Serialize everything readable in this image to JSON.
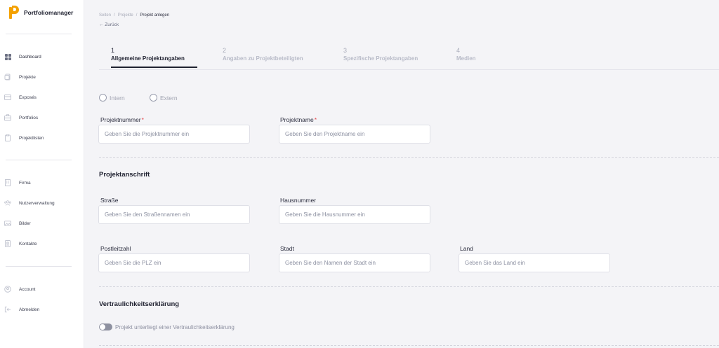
{
  "app": {
    "name": "Portfoliomanager",
    "brand_color": "#f4a100"
  },
  "sidebar": {
    "groups": [
      [
        {
          "label": "Dashboard",
          "icon": "dashboard-icon"
        },
        {
          "label": "Projekte",
          "icon": "projects-icon"
        },
        {
          "label": "Exposés",
          "icon": "expose-icon"
        },
        {
          "label": "Portfolios",
          "icon": "portfolio-icon"
        },
        {
          "label": "Projektlisten",
          "icon": "list-icon"
        }
      ],
      [
        {
          "label": "Firma",
          "icon": "building-icon"
        },
        {
          "label": "Nutzerverwaltung",
          "icon": "users-icon"
        },
        {
          "label": "Bilder",
          "icon": "image-icon"
        },
        {
          "label": "Kontakte",
          "icon": "contact-icon"
        }
      ],
      [
        {
          "label": "Account",
          "icon": "account-icon"
        },
        {
          "label": "Abmelden",
          "icon": "logout-icon"
        }
      ]
    ]
  },
  "breadcrumb": {
    "items": [
      "Seiten",
      "Projekte",
      "Projekt anlegen"
    ],
    "back": "← Zurück"
  },
  "steps": [
    {
      "num": "1",
      "label": "Allgemeine Projektangaben",
      "active": true
    },
    {
      "num": "2",
      "label": "Angaben zu Projektbeteiligten",
      "active": false
    },
    {
      "num": "3",
      "label": "Spezifische Projektangaben",
      "active": false
    },
    {
      "num": "4",
      "label": "Medien",
      "active": false
    }
  ],
  "form": {
    "type_options": [
      "Intern",
      "Extern"
    ],
    "projektnummer": {
      "label": "Projektnummer",
      "required_mark": "*",
      "placeholder": "Geben Sie die Projektnummer ein"
    },
    "projektname": {
      "label": "Projektname",
      "required_mark": "*",
      "placeholder": "Geben Sie den Projektname ein"
    },
    "address_title": "Projektanschrift",
    "strasse": {
      "label": "Straße",
      "placeholder": "Geben Sie den Straßennamen ein"
    },
    "hausnummer": {
      "label": "Hausnummer",
      "placeholder": "Geben Sie die Hausnummer ein"
    },
    "plz": {
      "label": "Postleitzahl",
      "placeholder": "Geben Sie die PLZ ein"
    },
    "stadt": {
      "label": "Stadt",
      "placeholder": "Geben Sie den Namen der Stadt ein"
    },
    "land": {
      "label": "Land",
      "placeholder": "Geben Sie das Land ein"
    },
    "confidential_title": "Vertraulichkeitserklärung",
    "confidential_toggle": "Projekt unterliegt einer Vertraulichkeitserklärung"
  }
}
